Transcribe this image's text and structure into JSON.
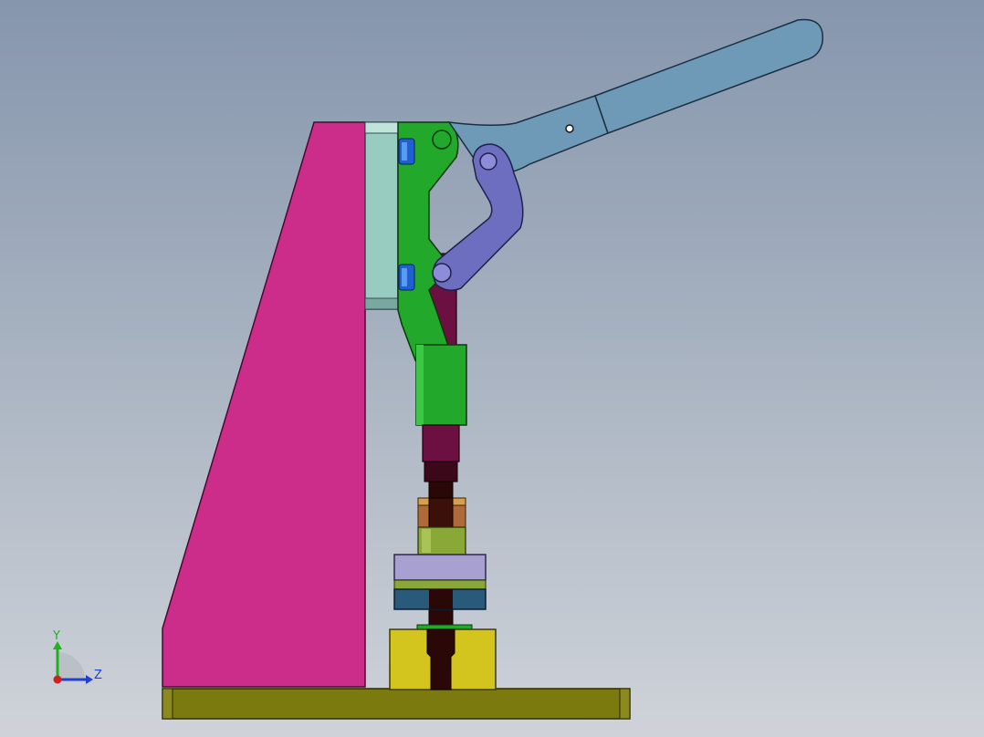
{
  "colors": {
    "background_top": "#8696ad",
    "background_bottom": "#cfd3d9",
    "frame_pink": "#cc2d8a",
    "mount_plate": "#98ccc0",
    "clamp_green": "#22a82a",
    "link_purple": "#6e6ec0",
    "handle_blue": "#6e9ab8",
    "plunger_maroon": "#6b1040",
    "base_olive": "#7a7a0f",
    "block_yellow": "#d4c41e",
    "bushing_lavender": "#a8a0d0",
    "bushing_teal": "#2a5a7a",
    "collar_olive": "#8aa838",
    "nut_orange": "#b06a3a",
    "bolt_blue": "#1f5fd0",
    "axis_x": "#d02020",
    "axis_y": "#20b020",
    "axis_z": "#2040d0"
  },
  "triad": {
    "y_label": "Y",
    "z_label": "Z"
  },
  "parts": [
    "handle-grip-icon",
    "frame-plate",
    "toggle-clamp-body",
    "toggle-link",
    "plunger-spindle",
    "guide-bushing",
    "base-plate",
    "support-block"
  ]
}
